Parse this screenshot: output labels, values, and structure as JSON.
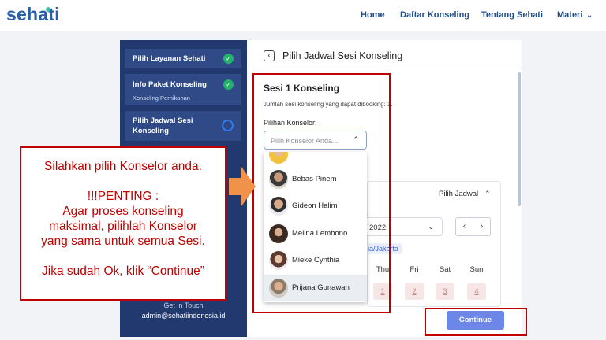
{
  "header": {
    "logo": "sehati",
    "nav": [
      "Home",
      "Daftar Konseling",
      "Tentang Sehati",
      "Materi"
    ]
  },
  "sidebar": {
    "steps": [
      {
        "title": "Pilih Layanan Sehati",
        "subtitle": "",
        "state": "done"
      },
      {
        "title": "Info Paket Konseling",
        "subtitle": "Konseling Pernikahan",
        "state": "done"
      },
      {
        "title": "Pilih Jadwal Sesi Konseling",
        "subtitle": "",
        "state": "current"
      }
    ],
    "get_in_touch": "Get in Touch",
    "email": "admin@sehatiindonesia.id"
  },
  "main": {
    "back_icon": "chevron-left-icon",
    "title": "Pilih Jadwal Sesi Konseling",
    "session_title": "Sesi 1 Konseling",
    "session_note": "Jumlah sesi konseling yang dapat dibooking: 1.",
    "counselor_label": "Pilihan Konselor:",
    "counselor_placeholder": "Pilih Konselor Anda...",
    "counselor_options": [
      "Bebas Pinem",
      "Gideon Halim",
      "Melina Lembono",
      "Mieke Cynthia",
      "Prijana Gunawan"
    ],
    "highlighted_option": "Prijana Gunawan",
    "schedule_label": "Pilih Jadwal",
    "month_value": "2022",
    "timezone": "ia/Jakarta",
    "day_headers": [
      "Thu",
      "Fri",
      "Sat",
      "Sun"
    ],
    "day_numbers": [
      "1",
      "2",
      "3",
      "4"
    ],
    "continue_label": "Continue"
  },
  "annotation": {
    "line1": "Silahkan pilih Konselor anda.",
    "line2": "!!!PENTING :",
    "line3": "Agar proses konseling",
    "line4": "maksimal, pilihlah Konselor",
    "line5": "yang sama untuk semua Sesi.",
    "line6": "Jika sudah Ok, klik “Continue”"
  },
  "colors": {
    "brand": "#2a5fa8",
    "sidebar": "#22396f",
    "done": "#25b06e",
    "current": "#2d7cf0",
    "annotation": "#c00000",
    "arrow": "#f0924a",
    "primary_button": "#6c87e8"
  }
}
